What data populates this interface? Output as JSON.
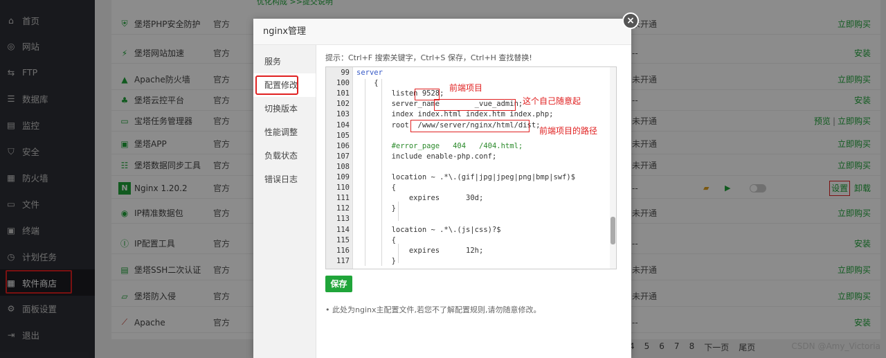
{
  "sidebar": {
    "items": [
      {
        "label": "首页",
        "icon": "home-icon"
      },
      {
        "label": "网站",
        "icon": "globe-icon"
      },
      {
        "label": "FTP",
        "icon": "ftp-icon"
      },
      {
        "label": "数据库",
        "icon": "database-icon"
      },
      {
        "label": "监控",
        "icon": "monitor-icon"
      },
      {
        "label": "安全",
        "icon": "shield-icon"
      },
      {
        "label": "防火墙",
        "icon": "firewall-icon"
      },
      {
        "label": "文件",
        "icon": "folder-icon"
      },
      {
        "label": "终端",
        "icon": "terminal-icon"
      },
      {
        "label": "计划任务",
        "icon": "clock-icon"
      },
      {
        "label": "软件商店",
        "icon": "grid-icon"
      },
      {
        "label": "面板设置",
        "icon": "gear-icon"
      },
      {
        "label": "退出",
        "icon": "logout-icon"
      }
    ],
    "active_index": 10
  },
  "plugins": {
    "top_partial_link": "优化构成 >>提交说明",
    "rows": [
      {
        "name": "堡塔PHP安全防护",
        "dev": "官方",
        "status": "未开通",
        "op": "立即购买"
      },
      {
        "name": "堡塔网站加速",
        "dev": "官方",
        "status": "--",
        "op": "安装"
      },
      {
        "name": "Apache防火墙",
        "dev": "官方",
        "status": "未开通",
        "op": "立即购买"
      },
      {
        "name": "堡塔云控平台",
        "dev": "官方",
        "status": "--",
        "op": "安装"
      },
      {
        "name": "宝塔任务管理器",
        "dev": "官方",
        "status": "未开通",
        "op_a": "预览",
        "op_sep": "|",
        "op_b": "立即购买"
      },
      {
        "name": "堡塔APP",
        "dev": "官方",
        "status": "未开通",
        "op": "立即购买"
      },
      {
        "name": "堡塔数据同步工具",
        "dev": "官方",
        "status": "未开通",
        "op": "立即购买"
      },
      {
        "name": "Nginx 1.20.2",
        "dev": "官方",
        "status": "--",
        "op_a": "设置",
        "op_b": "卸载"
      },
      {
        "name": "IP精准数据包",
        "dev": "官方",
        "status": "未开通",
        "op": "立即购买"
      },
      {
        "name": "IP配置工具",
        "dev": "官方",
        "status": "--",
        "op": "安装"
      },
      {
        "name": "堡塔SSH二次认证",
        "dev": "官方",
        "status": "未开通",
        "op": "立即购买"
      },
      {
        "name": "堡塔防入侵",
        "dev": "官方",
        "status": "未开通",
        "op": "立即购买"
      },
      {
        "name": "Apache",
        "dev": "官方",
        "status": "--",
        "op": "安装"
      }
    ]
  },
  "pager": {
    "pages": [
      "4",
      "5",
      "6",
      "7",
      "8"
    ],
    "next": "下一页",
    "last": "尾页"
  },
  "watermark": "CSDN @Amy_Victoria",
  "modal": {
    "title": "nginx管理",
    "close_label": "×",
    "nav": [
      "服务",
      "配置修改",
      "切换版本",
      "性能调整",
      "负载状态",
      "错误日志"
    ],
    "active_nav": 1,
    "tips": "提示：Ctrl+F 搜索关键字，Ctrl+S 保存，Ctrl+H 查找替换!",
    "save_label": "保存",
    "note": "此处为nginx主配置文件,若您不了解配置规则,请勿随意修改。",
    "code_lines": [
      {
        "n": "99",
        "text": "server"
      },
      {
        "n": "100",
        "text": "    {"
      },
      {
        "n": "101",
        "text": "        listen 9528;"
      },
      {
        "n": "102",
        "text": "        server_name        _vue_admin;"
      },
      {
        "n": "103",
        "text": "        index index.html index.htm index.php;"
      },
      {
        "n": "104",
        "text": "        root  /www/server/nginx/html/dist;"
      },
      {
        "n": "105",
        "text": ""
      },
      {
        "n": "106",
        "text": "        #error_page   404   /404.html;"
      },
      {
        "n": "107",
        "text": "        include enable-php.conf;"
      },
      {
        "n": "108",
        "text": ""
      },
      {
        "n": "109",
        "text": "        location ~ .*\\.(gif|jpg|jpeg|png|bmp|swf)$"
      },
      {
        "n": "110",
        "text": "        {"
      },
      {
        "n": "111",
        "text": "            expires      30d;"
      },
      {
        "n": "112",
        "text": "        }"
      },
      {
        "n": "113",
        "text": ""
      },
      {
        "n": "114",
        "text": "        location ~ .*\\.(js|css)?$"
      },
      {
        "n": "115",
        "text": "        {"
      },
      {
        "n": "116",
        "text": "            expires      12h;"
      },
      {
        "n": "117",
        "text": "        }"
      }
    ],
    "annotations": {
      "a1": "前端项目",
      "a2": "这个自己随意起",
      "a3": "前端项目的路径"
    }
  }
}
